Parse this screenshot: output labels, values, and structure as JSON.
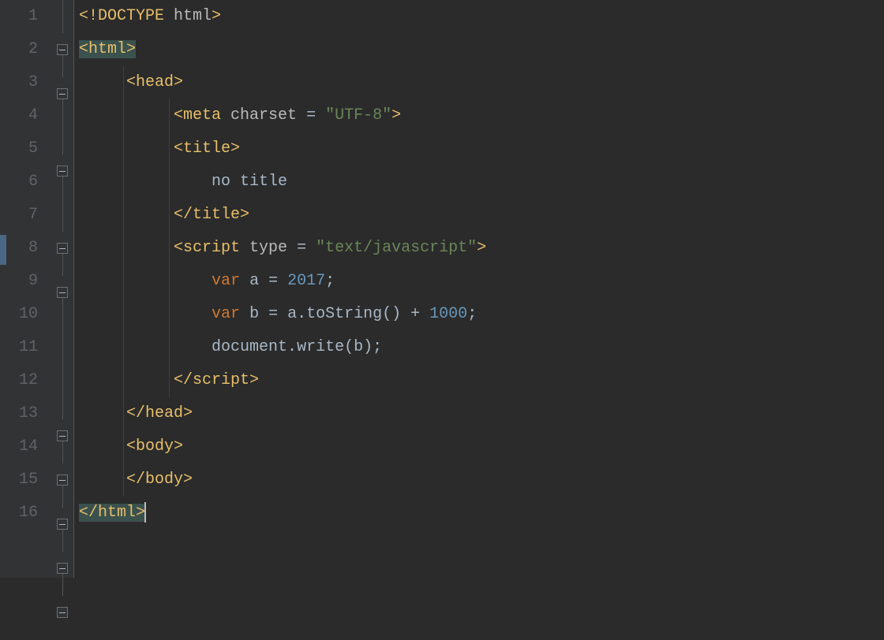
{
  "lines": {
    "l1": "1",
    "l2": "2",
    "l3": "3",
    "l4": "4",
    "l5": "5",
    "l6": "6",
    "l7": "7",
    "l8": "8",
    "l9": "9",
    "l10": "10",
    "l11": "11",
    "l12": "12",
    "l13": "13",
    "l14": "14",
    "l15": "15",
    "l16": "16"
  },
  "t": {
    "doctype_open": "<!DOCTYPE ",
    "doctype_name": "html",
    "angle_close": ">",
    "html_open": "<html>",
    "html_close": "</html>",
    "head_open": "<head>",
    "head_close": "</head>",
    "meta_open": "<meta ",
    "charset_attr": "charset",
    "eq_sp": " = ",
    "utf8": "\"UTF-8\"",
    "title_open": "<title>",
    "title_close": "</title>",
    "title_text": "no title",
    "script_open": "<script ",
    "type_attr": "type",
    "textjs": "\"text/javascript\"",
    "script_close": "</script>",
    "var_kw": "var",
    "sp": " ",
    "a_id": "a",
    "b_id": "b",
    "eq": " = ",
    "n2017": "2017",
    "semi": ";",
    "dot": ".",
    "toString": "toString",
    "parens": "()",
    "plus": " + ",
    "n1000": "1000",
    "document": "document",
    "write": "write",
    "openp": "(",
    "closep": ")",
    "body_open": "<body>",
    "body_close": "</body>"
  }
}
